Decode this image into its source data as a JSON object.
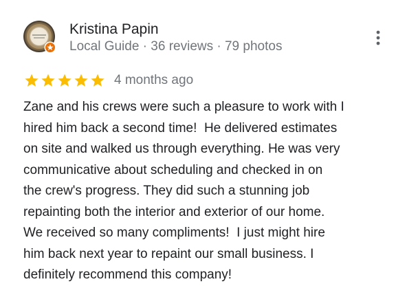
{
  "reviewer": {
    "name": "Kristina Papin",
    "meta": "Local Guide · 36 reviews · 79 photos"
  },
  "review": {
    "rating": 5,
    "rating_max": 5,
    "date": "4 months ago",
    "lines": [
      "Zane and his crews were such a pleasure to work with I",
      "hired him back a second time!  He delivered estimates",
      "on site and walked us through everything. He was very",
      "communicative about scheduling and checked in on",
      "the crew's progress. They did such a stunning job",
      "repainting both the interior and exterior of our home.",
      "We received so many compliments!  I just might hire",
      "him back next year to repaint our small business. I",
      "definitely recommend this company!"
    ]
  },
  "icons": {
    "star": "star-icon",
    "badge": "local-guide-badge-icon",
    "more": "more-vert-icon"
  },
  "colors": {
    "star": "#fbbc04",
    "badge": "#e8710a",
    "meta_text": "#70757a",
    "body_text": "#202124"
  }
}
